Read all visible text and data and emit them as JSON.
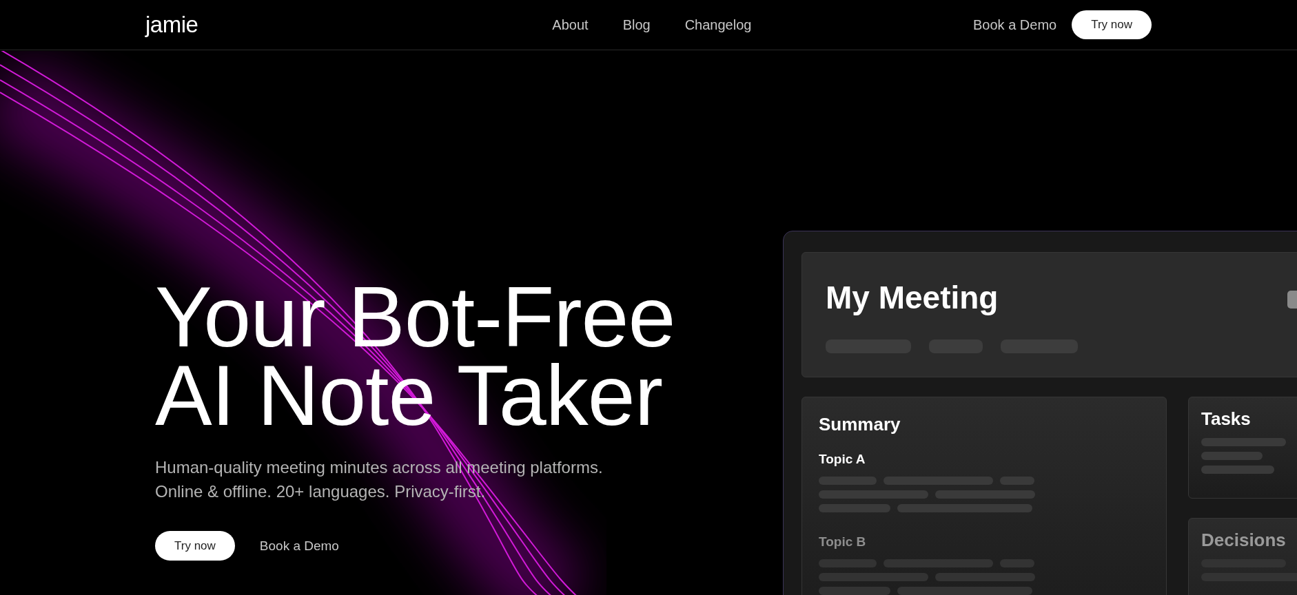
{
  "header": {
    "logo": "jamie",
    "nav": [
      "About",
      "Blog",
      "Changelog"
    ],
    "book_demo": "Book a Demo",
    "try_now": "Try now"
  },
  "hero": {
    "title_lines": [
      "Your Bot-Free",
      "AI Note Taker"
    ],
    "subtitle_lines": [
      "Human-quality meeting minutes across all meeting platforms.",
      "Online & offline. 20+ languages. Privacy-first."
    ],
    "primary_button": "Try now",
    "secondary_link": "Book a Demo"
  },
  "mockup": {
    "title": "My Meeting",
    "summary": {
      "heading": "Summary",
      "topics": [
        {
          "title": "Topic A",
          "faded": false
        },
        {
          "title": "Topic B",
          "faded": true
        }
      ]
    },
    "side_panels": [
      {
        "heading": "Tasks",
        "faded": false
      },
      {
        "heading": "Decisions",
        "faded": true
      }
    ]
  }
}
